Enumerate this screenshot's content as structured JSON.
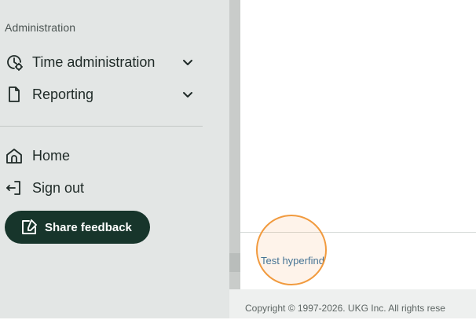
{
  "sidebar": {
    "section_title": "Administration",
    "items": [
      {
        "label": "Time administration",
        "icon": "clock-settings-icon",
        "expandable": true
      },
      {
        "label": "Reporting",
        "icon": "document-icon",
        "expandable": true
      }
    ],
    "bottom_items": [
      {
        "label": "Home",
        "icon": "home-icon"
      },
      {
        "label": "Sign out",
        "icon": "sign-out-icon"
      }
    ],
    "feedback_button": {
      "label": "Share feedback",
      "icon": "edit-note-icon"
    }
  },
  "main": {
    "link_text": "Test hyperfind"
  },
  "footer": {
    "copyright": "Copyright © 1997-2026. UKG Inc. All rights rese"
  },
  "colors": {
    "sidebar_bg": "#e3e6e5",
    "feedback_bg": "#17352b",
    "link": "#2f6f9f",
    "highlight": "#f19a3e"
  }
}
